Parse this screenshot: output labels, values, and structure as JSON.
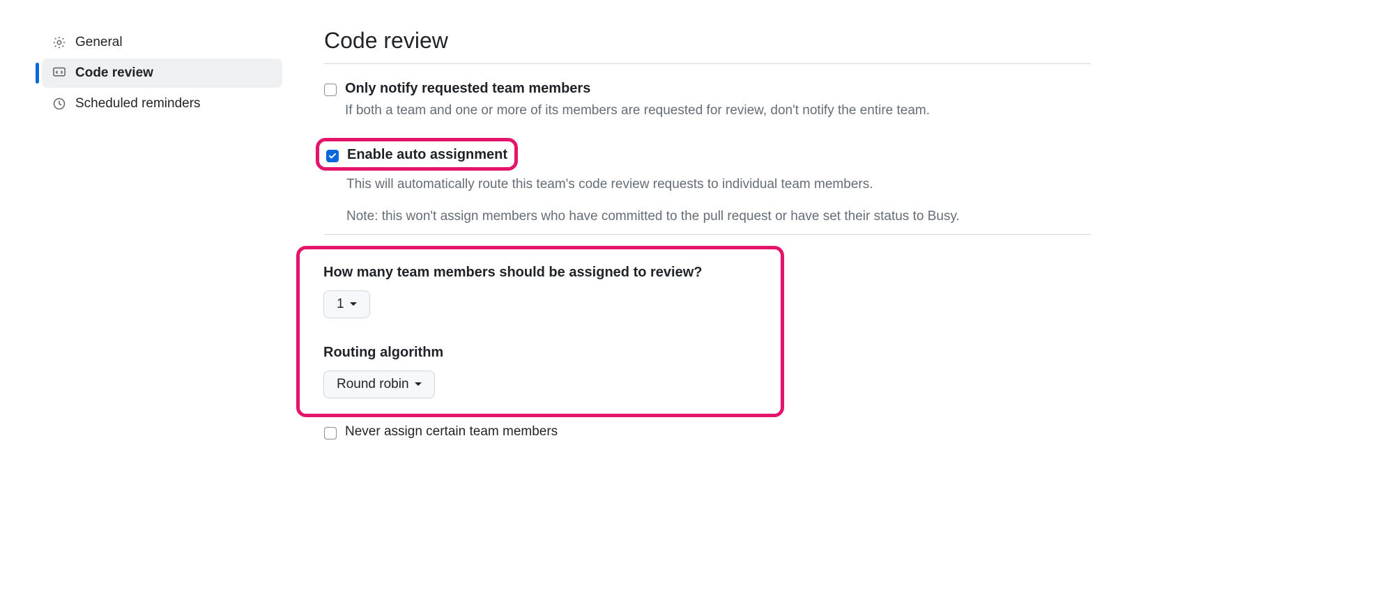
{
  "sidebar": {
    "items": [
      {
        "label": "General",
        "active": false
      },
      {
        "label": "Code review",
        "active": true
      },
      {
        "label": "Scheduled reminders",
        "active": false
      }
    ]
  },
  "page": {
    "title": "Code review"
  },
  "settings": {
    "only_notify": {
      "label": "Only notify requested team members",
      "desc": "If both a team and one or more of its members are requested for review, don't notify the entire team.",
      "checked": false
    },
    "auto_assign": {
      "label": "Enable auto assignment",
      "desc": "This will automatically route this team's code review requests to individual team members.",
      "note": "Note: this won't assign members who have committed to the pull request or have set their status to Busy.",
      "checked": true
    },
    "reviewers_count": {
      "label": "How many team members should be assigned to review?",
      "value": "1"
    },
    "routing": {
      "label": "Routing algorithm",
      "value": "Round robin"
    },
    "never_assign": {
      "label": "Never assign certain team members",
      "checked": false
    }
  }
}
